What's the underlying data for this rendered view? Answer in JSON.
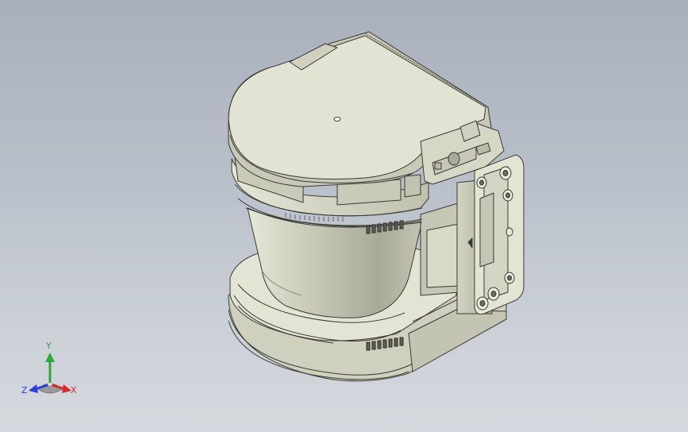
{
  "view": {
    "background_top": "#a8b0bc",
    "background_bottom": "#d6d9de",
    "part_color": "#d9dbc9",
    "edge_color": "#3a3a34"
  },
  "triad": {
    "y_label": "Y",
    "x_label": "X",
    "z_label": "Z",
    "y_color": "#2fa83a",
    "x_color": "#d42a2a",
    "z_color": "#2a3fd4"
  }
}
